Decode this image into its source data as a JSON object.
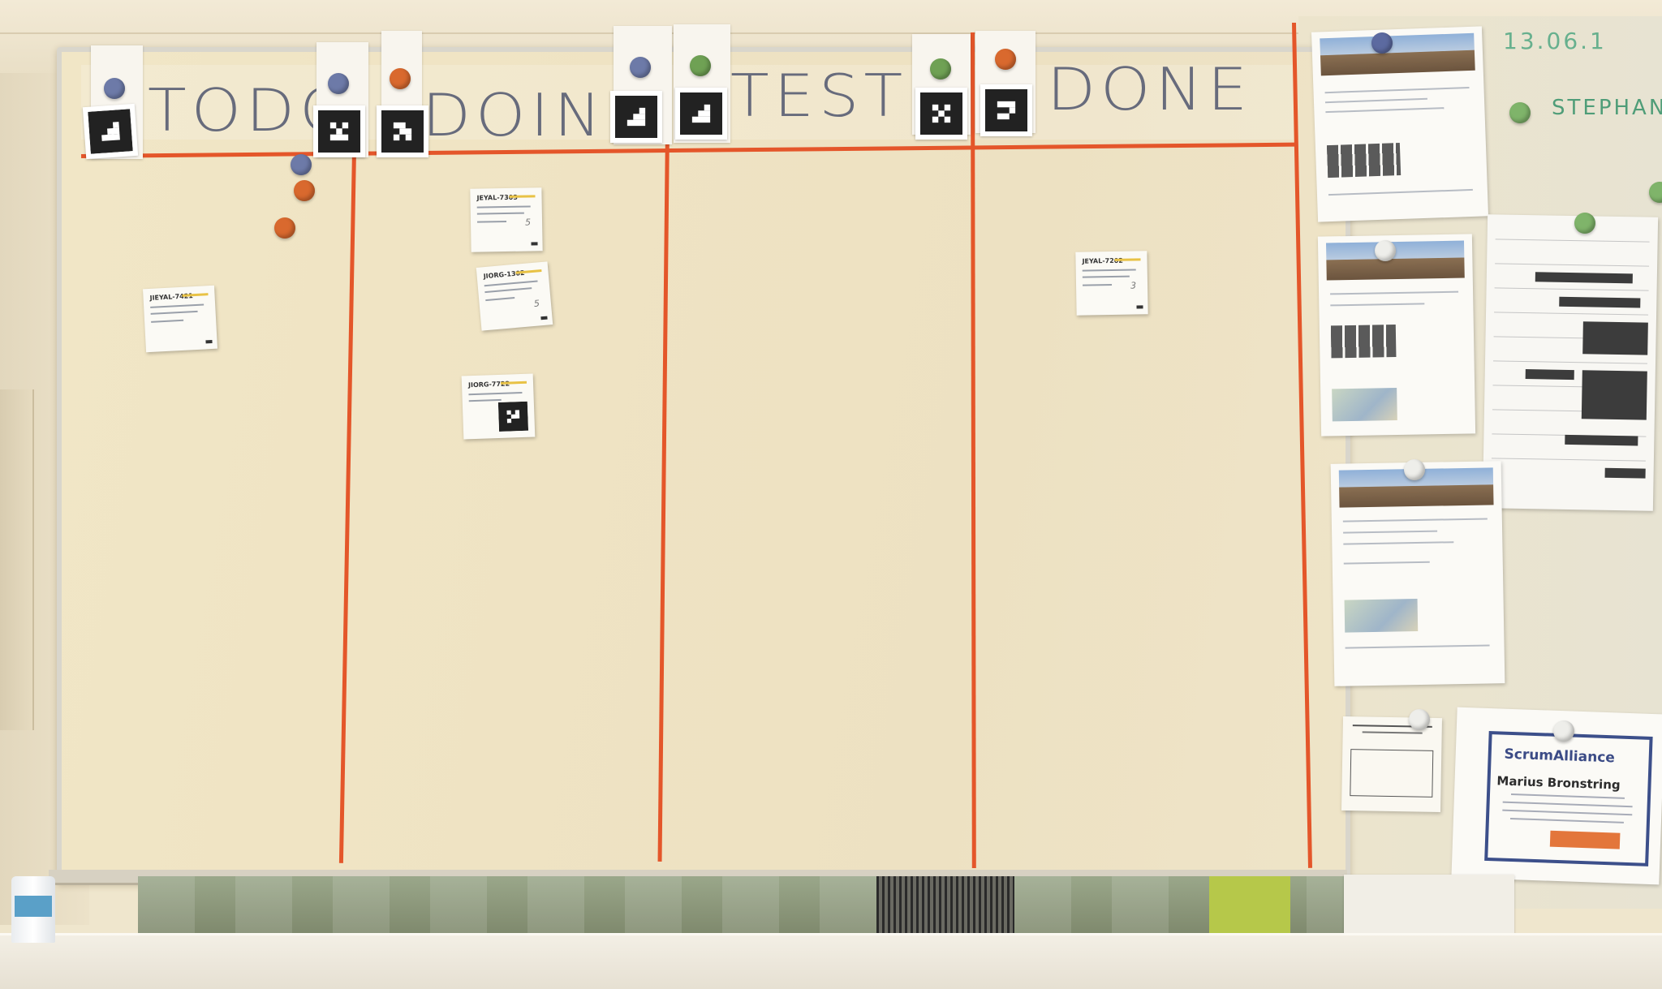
{
  "board": {
    "columns": [
      {
        "key": "todo",
        "label": "TODO"
      },
      {
        "key": "doing",
        "label": "DOING"
      },
      {
        "key": "test",
        "label": "TEST"
      },
      {
        "key": "done",
        "label": "DONE"
      }
    ]
  },
  "cards": {
    "todo_card": {
      "id": "JIEYAL-7421"
    },
    "doing_card_1": {
      "id": "JEYAL-7303",
      "estimate": "5"
    },
    "doing_card_2": {
      "id": "JIORG-1302",
      "estimate": "5"
    },
    "doing_card_3": {
      "id": "JIORG-7722"
    },
    "done_card": {
      "id": "JEYAL-7202",
      "estimate": "3"
    }
  },
  "wall": {
    "handwritten_date": "13.06.1",
    "handwritten_name": "STEPHAN"
  },
  "certificate": {
    "brand": "ScrumAlliance",
    "holder": "Marius Bronstring"
  },
  "colors": {
    "tape": "#e4562a",
    "magnet_blue": "#6d7aa8",
    "magnet_orange": "#d9692e",
    "magnet_green": "#6fa154"
  },
  "icons": {
    "markers": "fiducial-marker-icon",
    "magnets": "magnet-icon"
  }
}
